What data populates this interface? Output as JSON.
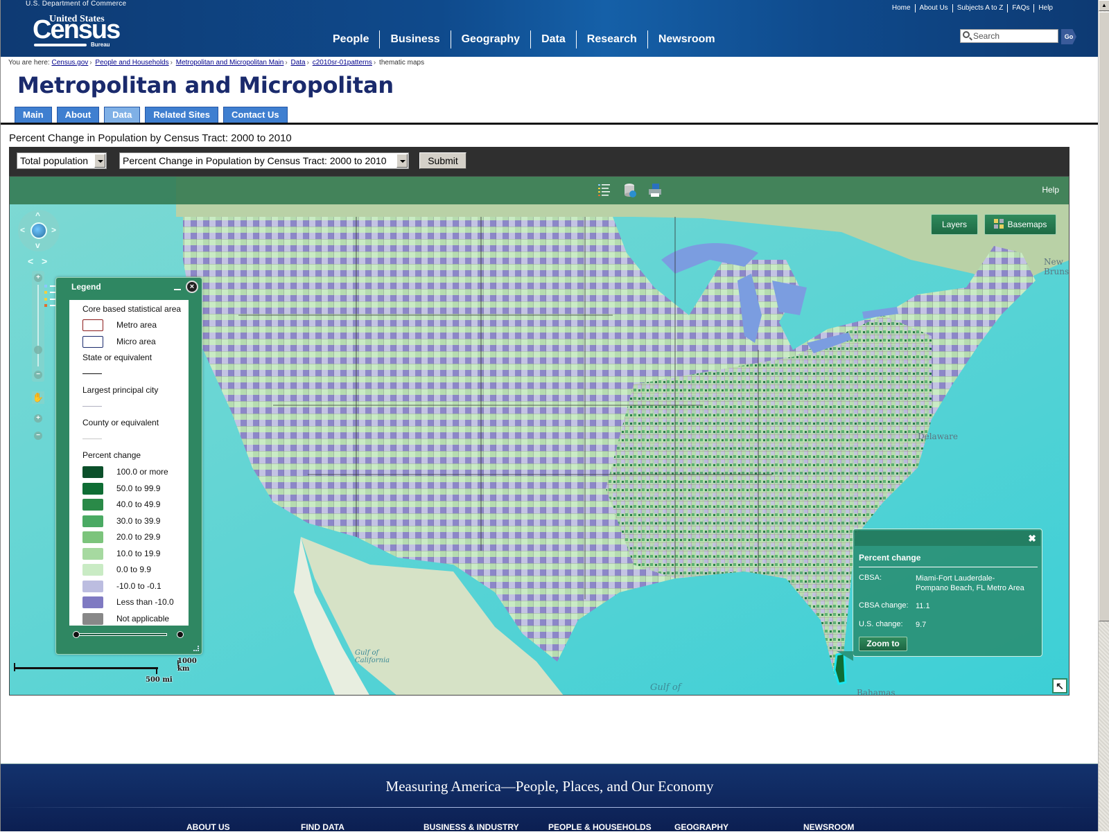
{
  "header": {
    "department": "U.S. Department of Commerce",
    "logo": {
      "top": "United States",
      "main": "Census",
      "sub": "Bureau"
    },
    "top_links": [
      "Home",
      "About Us",
      "Subjects A to Z",
      "FAQs",
      "Help"
    ],
    "main_nav": [
      "People",
      "Business",
      "Geography",
      "Data",
      "Research",
      "Newsroom"
    ],
    "search_placeholder": "Search",
    "go_label": "Go"
  },
  "breadcrumb": {
    "prefix": "You are here:",
    "links": [
      "Census.gov",
      "People and Households",
      "Metropolitan and Micropolitan Main",
      "Data",
      "c2010sr-01patterns"
    ],
    "current": "thematic maps",
    "separator": "›"
  },
  "page": {
    "title": "Metropolitan and Micropolitan",
    "tabs": [
      {
        "label": "Main",
        "active": false
      },
      {
        "label": "About",
        "active": false
      },
      {
        "label": "Data",
        "active": true
      },
      {
        "label": "Related Sites",
        "active": false
      },
      {
        "label": "Contact Us",
        "active": false
      }
    ]
  },
  "map_section": {
    "title": "Percent Change in Population by Census Tract: 2000 to 2010",
    "select_population": "Total population",
    "select_map": "Percent Change in Population by Census Tract: 2000 to 2010",
    "submit_label": "Submit"
  },
  "map": {
    "toolbar": {
      "icons": [
        "legend-icon",
        "database-icon",
        "print-icon"
      ],
      "help_label": "Help"
    },
    "layers_label": "Layers",
    "basemaps_label": "Basemaps",
    "labels": [
      "New Brunswick",
      "Delaware",
      "Gulf of California",
      "Gulf of",
      "Bahamas"
    ],
    "scale": {
      "km": "1000 km",
      "mi": "500 mi"
    }
  },
  "legend": {
    "title": "Legend",
    "sections": {
      "cbsa_title": "Core based statistical area",
      "metro": "Metro area",
      "micro": "Micro area",
      "state": "State or equivalent",
      "city": "Largest principal city",
      "county": "County or equivalent",
      "pct_title": "Percent change"
    },
    "classes": [
      {
        "label": "100.0 or more",
        "color": "#0b4f2a"
      },
      {
        "label": "50.0 to 99.9",
        "color": "#0f6d34"
      },
      {
        "label": "40.0 to 49.9",
        "color": "#2a8a48"
      },
      {
        "label": "30.0 to 39.9",
        "color": "#4aaa63"
      },
      {
        "label": "20.0 to 29.9",
        "color": "#7cc47c"
      },
      {
        "label": "10.0 to 19.9",
        "color": "#a6d9a0"
      },
      {
        "label": "0.0 to 9.9",
        "color": "#c9ebc4"
      },
      {
        "label": "-10.0 to -0.1",
        "color": "#bcbde0"
      },
      {
        "label": "Less than -10.0",
        "color": "#7f7ac2"
      },
      {
        "label": "Not applicable",
        "color": "#888888"
      }
    ]
  },
  "popup": {
    "title": "Percent change",
    "cbsa_key": "CBSA:",
    "cbsa_value_line1": "Miami-Fort Lauderdale-",
    "cbsa_value_line2": "Pompano Beach, FL Metro Area",
    "cbsa_change_key": "CBSA change:",
    "cbsa_change_value": "11.1",
    "us_change_key": "U.S. change:",
    "us_change_value": "9.7",
    "zoom_label": "Zoom to"
  },
  "footer": {
    "tagline": "Measuring America—People, Places, and Our Economy",
    "nav": [
      "ABOUT US",
      "FIND DATA",
      "BUSINESS & INDUSTRY",
      "PEOPLE & HOUSEHOLDS",
      "GEOGRAPHY",
      "NEWSROOM"
    ]
  }
}
